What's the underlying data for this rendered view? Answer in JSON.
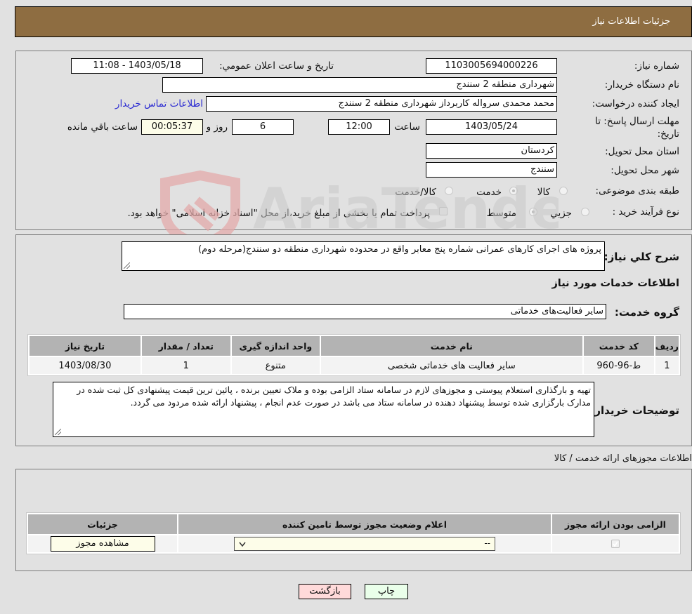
{
  "header": {
    "title": "جزئیات اطلاعات نیاز"
  },
  "info": {
    "need_number_label": "شماره نیاز:",
    "need_number": "1103005694000226",
    "announce_label": "تاریخ و ساعت اعلان عمومي:",
    "announce_value": "1403/05/18 - 11:08",
    "buyer_org_label": "نام دستگاه خريدار:",
    "buyer_org": "شهرداری منطقه 2 سنندج",
    "creator_label": "ایجاد کننده درخواست:",
    "creator": "محمد محمدی سرواله کاربرداز شهرداری منطقه 2 سنندج",
    "contact_link": "اطلاعات تماس خریدار",
    "deadline_label": "مهلت ارسال پاسخ: تا تاریخ:",
    "deadline_date": "1403/05/24",
    "time_label": "ساعت",
    "deadline_time": "12:00",
    "days": "6",
    "days_label": "روز و",
    "remaining_time": "00:05:37",
    "remaining_label": "ساعت باقي مانده",
    "province_label": "استان محل تحویل:",
    "province": "کردستان",
    "city_label": "شهر محل تحویل:",
    "city": "سنندج",
    "category_label": "طبقه بندی موضوعی:",
    "category_options": [
      {
        "label": "کالا",
        "selected": false
      },
      {
        "label": "خدمت",
        "selected": true
      },
      {
        "label": "کالا/خدمت",
        "selected": false
      }
    ],
    "process_label": "نوع فرآیند خرید :",
    "process_options": [
      {
        "label": "جزيي",
        "selected": false
      },
      {
        "label": "متوسط",
        "selected": true
      }
    ],
    "treasury_note": "پرداخت تمام یا بخشی از مبلغ خرید،از محل \"اسناد خزانه اسلامی\" خواهد بود.",
    "treasury_checked": false
  },
  "details": {
    "summary_label": "شرح کلي نياز:",
    "summary": "پروژه های اجرای کارهای عمرانی شماره پنج معابر واقع در محدوده شهرداری منطقه دو سنندج(مرحله دوم)",
    "services_heading": "اطلاعات خدمات مورد نیاز",
    "service_group_label": "گروه خدمت:",
    "service_group": "سایر فعالیت‌های خدماتی",
    "table": {
      "headers": [
        "ردیف",
        "کد خدمت",
        "نام خدمت",
        "واحد اندازه گیری",
        "تعداد / مقدار",
        "تاریخ نیاز"
      ],
      "rows": [
        [
          "1",
          "ط-96-960",
          "سایر فعالیت های خدماتی شخصی",
          "متنوع",
          "1",
          "1403/08/30"
        ]
      ]
    },
    "buyer_notes_label": "توضیحات خریدار:",
    "buyer_notes": "تهیه و بارگذاری استعلام پیوستی و مجوزهای لازم در سامانه ستاد الزامی بوده و ملاک تعیین برنده ، پائین ترین قیمت پیشنهادی کل ثبت شده در مدارک بارگزاری شده توسط پیشنهاد دهنده در سامانه ستاد می باشد در صورت عدم انجام ، پیشنهاد ارائه شده مردود می گردد."
  },
  "permits": {
    "heading": "اطلاعات مجوزهای ارائه خدمت / کالا",
    "headers": [
      "الزامی بودن ارائه مجوز",
      "اعلام وضعیت مجوز توسط تامین کننده",
      "جزئیات"
    ],
    "row": {
      "required_checked": true,
      "status_value": "--",
      "view_button": "مشاهده مجوز"
    }
  },
  "actions": {
    "print": "چاپ",
    "back": "بازگشت"
  },
  "watermark": "AriaTender.neT"
}
